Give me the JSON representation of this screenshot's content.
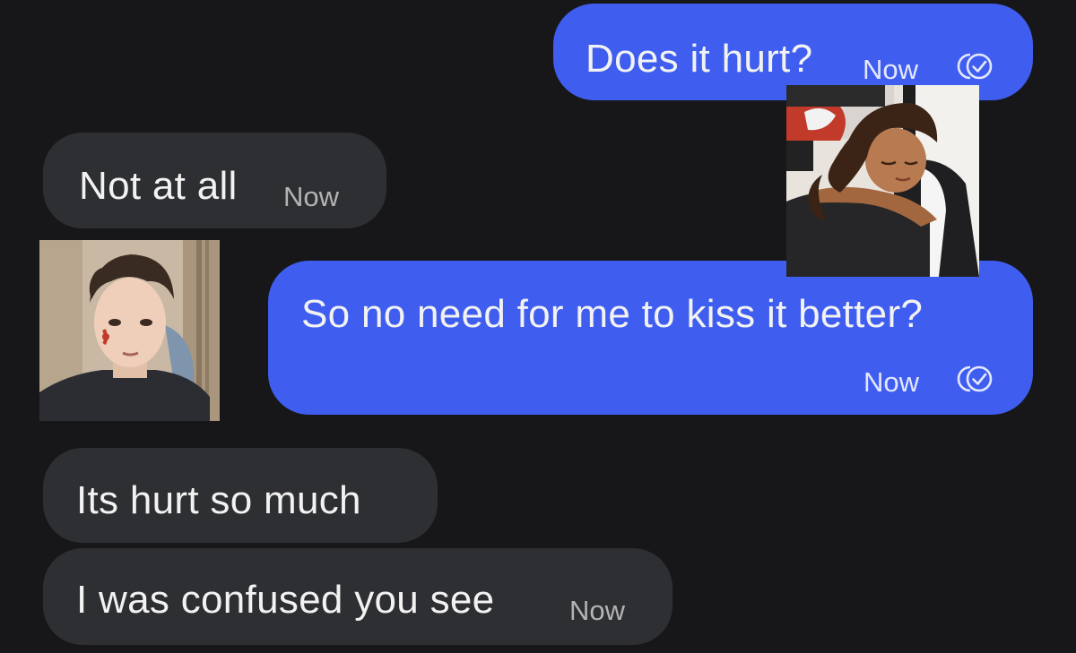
{
  "colors": {
    "background": "#17171a",
    "incoming_bubble": "#2e2f32",
    "outgoing_bubble": "#3f5ef0",
    "text": "#f2f2f2",
    "timestamp_incoming": "#b3b3b3",
    "timestamp_outgoing": "#e4e8ff"
  },
  "messages": [
    {
      "direction": "outgoing",
      "text": "Does it hurt?",
      "time": "Now",
      "status_icon": "read-receipt-icon"
    },
    {
      "direction": "incoming",
      "text": "Not at all",
      "time": "Now"
    },
    {
      "direction": "outgoing",
      "text": "So no need for me to kiss it better?",
      "time": "Now",
      "status_icon": "read-receipt-icon"
    },
    {
      "direction": "incoming",
      "text": "Its hurt so much"
    },
    {
      "direction": "incoming",
      "text": "I was confused you see",
      "time": "Now"
    }
  ],
  "photos": [
    {
      "name": "young-man-bruised-face-photo"
    },
    {
      "name": "woman-resting-head-photo"
    }
  ]
}
